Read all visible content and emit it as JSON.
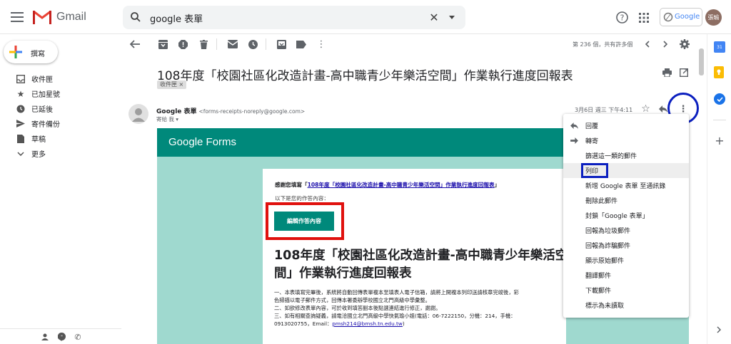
{
  "header": {
    "app_name": "Gmail",
    "search_query": "google 表單",
    "account_logo_text": "Google",
    "avatar_text": "張瑜"
  },
  "compose": {
    "label": "撰寫"
  },
  "sidebar": {
    "items": [
      {
        "label": "收件匣",
        "icon": "inbox-icon"
      },
      {
        "label": "已加星號",
        "icon": "star-icon"
      },
      {
        "label": "已延後",
        "icon": "clock-icon"
      },
      {
        "label": "寄件備份",
        "icon": "send-icon"
      },
      {
        "label": "草稿",
        "icon": "draft-icon"
      },
      {
        "label": "更多",
        "icon": "chevron-down-icon"
      }
    ]
  },
  "toolbar": {
    "pagination": "第 236 個，共有許多個"
  },
  "email": {
    "subject": "108年度「校園社區化改造計畫-高中職青少年樂活空間」作業執行進度回報表",
    "label_chip": "收件匣 ×",
    "sender_name": "Google 表單",
    "sender_email": "<forms-receipts-noreply@google.com>",
    "to_line": "寄給 我 ▾",
    "date": "3月6日 週三 下午4:11"
  },
  "body": {
    "brand": "Google Forms",
    "thanks_prefix": "感謝您填寫「",
    "thanks_link": "108年度「校園社區化改造計畫-高中職青少年樂活空間」作業執行進度回報表",
    "thanks_suffix": "」",
    "intro": "以下是您的作答內容：",
    "edit_button": "編輯作答內容",
    "heading_line1": "108年度「校園社區化改造計畫-高中職青少年樂活空",
    "heading_line2": "間」作業執行進度回報表",
    "para1a": "一、本表填寫完畢後，系統將自動回傳表單複本至填表人電子信箱，請將上開複本列印送請核章完竣後，彩",
    "para1b": "色掃描以電子郵件方式，回傳本署委辦學校國立北門高級中學彙整。",
    "para2": "二、如欲修改表單內容，可於收到填答副本後點選連結進行修正，謝謝。",
    "para3a": "三、如有相關查詢疑義，請電洽國立北門高級中學快氣瑜小姐(電話：06-7222150，分機：214，手機：",
    "para3b_prefix": "0913020755，Email：",
    "para3b_email": "pmsh214@bmsh.tn.edu.tw",
    "para3b_suffix": ")"
  },
  "menu": {
    "items": [
      "回覆",
      "轉寄",
      "篩選這一類的郵件",
      "列印",
      "新增 Google 表單 至通訊錄",
      "刪除此郵件",
      "封鎖「Google 表單」",
      "回報為垃圾郵件",
      "回報為詐騙郵件",
      "顯示原始郵件",
      "翻譯郵件",
      "下載郵件",
      "標示為未讀取"
    ]
  },
  "colors": {
    "gmail_red": "#ea4335",
    "forms_teal": "#00897b",
    "highlight_blue": "#0b1fbf",
    "highlight_red": "#e0110e"
  }
}
